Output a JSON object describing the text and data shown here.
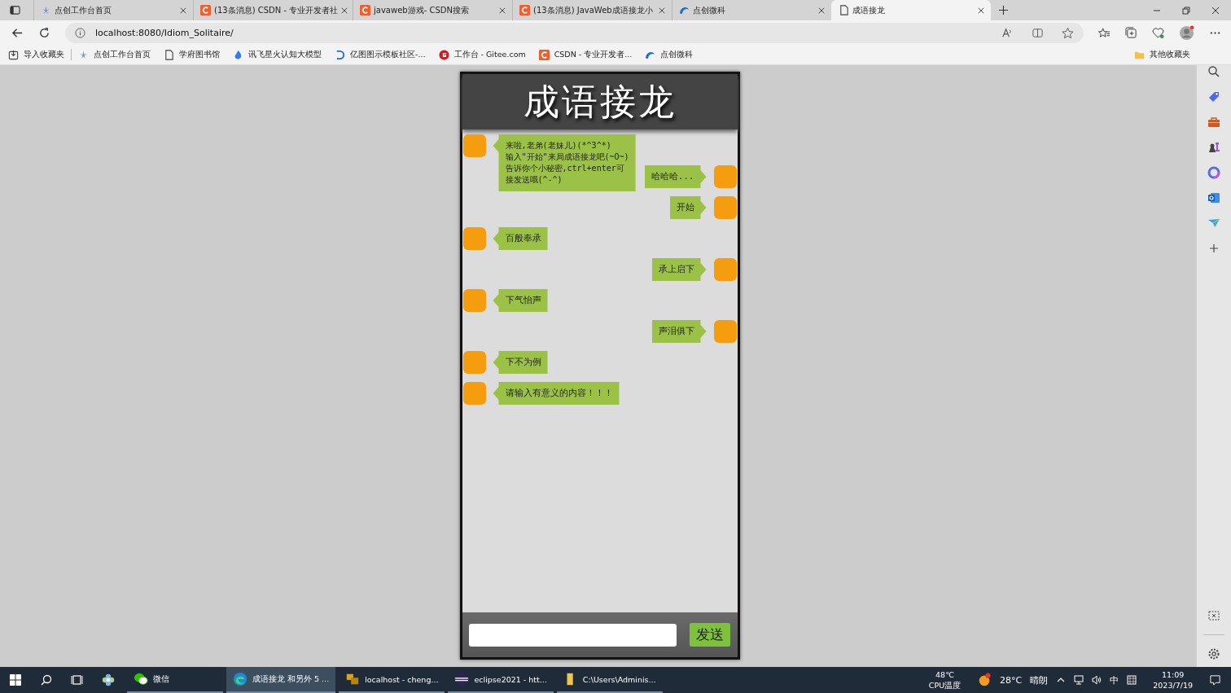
{
  "tabs": [
    {
      "title": "点创工作台首页",
      "selected": false
    },
    {
      "title": "(13条消息) CSDN - 专业开发者社",
      "selected": false
    },
    {
      "title": "javaweb游戏- CSDN搜索",
      "selected": false
    },
    {
      "title": "(13条消息) JavaWeb成语接龙小",
      "selected": false
    },
    {
      "title": "点创微科",
      "selected": false
    },
    {
      "title": "成语接龙",
      "selected": true
    }
  ],
  "address": "localhost:8080/Idiom_Solitaire/",
  "bookmarks": [
    "导入收藏夹",
    "点创工作台首页",
    "学府图书馆",
    "讯飞星火认知大模型",
    "亿图图示模板社区-...",
    "工作台 - Gitee.com",
    "CSDN - 专业开发者...",
    "点创微科"
  ],
  "other_bookmarks": "其他收藏夹",
  "app": {
    "title": "成语接龙",
    "messages": [
      {
        "kind": "received",
        "lines": [
          "来啦,老弟(老妹儿)(*^3^*)",
          "输入\"开始\"来局成语接龙吧(~O~)",
          "告诉你个小秘密,ctrl+enter可",
          "接发送哦(^-^)"
        ]
      },
      {
        "kind": "sent",
        "lines": [
          "哈哈哈..."
        ]
      },
      {
        "kind": "sent",
        "lines": [
          "开始"
        ]
      },
      {
        "kind": "received",
        "lines": [
          "百般奉承"
        ]
      },
      {
        "kind": "sent",
        "lines": [
          "承上启下"
        ]
      },
      {
        "kind": "received",
        "lines": [
          "下气怡声"
        ]
      },
      {
        "kind": "sent",
        "lines": [
          "声泪俱下"
        ]
      },
      {
        "kind": "received",
        "lines": [
          "下不为例"
        ]
      },
      {
        "kind": "received",
        "lines": [
          "请输入有意义的内容！！！"
        ]
      }
    ],
    "send_button": "发送"
  },
  "taskbar": {
    "apps": [
      {
        "label": "微信",
        "selected": false
      },
      {
        "label": "成语接龙 和另外 5 ...",
        "selected": true
      },
      {
        "label": "localhost - cheng...",
        "selected": false
      },
      {
        "label": "eclipse2021 - htt...",
        "selected": false
      },
      {
        "label": "C:\\Users\\Adminis...",
        "selected": false
      }
    ],
    "cpu_temp": "48℃",
    "cpu_label": "CPU温度",
    "weather": "28°C",
    "weather_text": "晴朗",
    "ime": "中",
    "time": "11:09",
    "date": "2023/7/19"
  }
}
